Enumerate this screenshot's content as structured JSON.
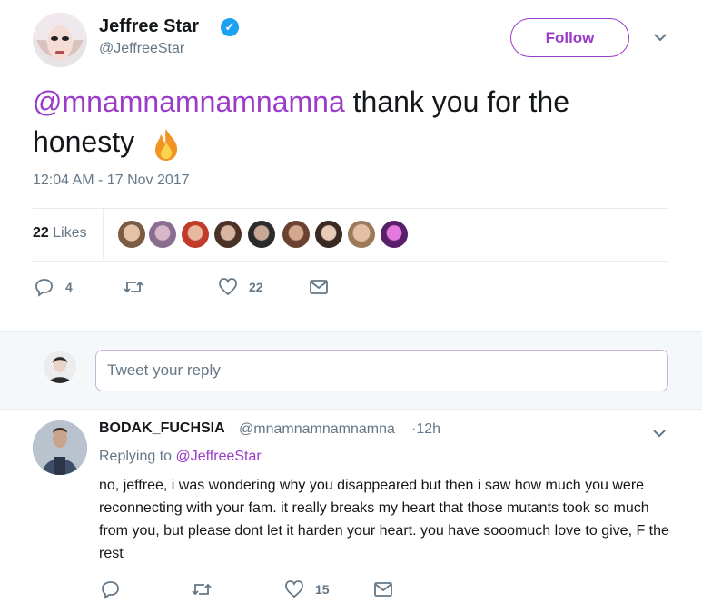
{
  "tweet": {
    "display_name": "Jeffree Star",
    "handle": "@JeffreeStar",
    "follow_label": "Follow",
    "text_mention": "@mnamnamnamnamna",
    "text_body": " thank you for the honesty",
    "emoji": "fire-emoji",
    "timestamp": "12:04 AM - 17 Nov 2017",
    "likes_number": "22",
    "likes_label": "Likes",
    "reply_count": "4",
    "retweet_count": "",
    "like_count": "22",
    "accent_color": "#9b3cc8",
    "verified_color": "#1da1f2"
  },
  "reply_box": {
    "placeholder": "Tweet your reply"
  },
  "reply": {
    "display_name": "BODAK_FUCHSIA",
    "handle": "@mnamnamnamnamna",
    "time": "·12h",
    "replying_prefix": "Replying to ",
    "replying_to": "@JeffreeStar",
    "text": "no, jeffree, i was wondering why you disappeared but then i saw how much you were reconnecting with your fam. it really breaks my heart that those mutants took so much from you, but please dont let it harden your heart. you have sooomuch love to give, F the rest",
    "like_count": "15"
  }
}
